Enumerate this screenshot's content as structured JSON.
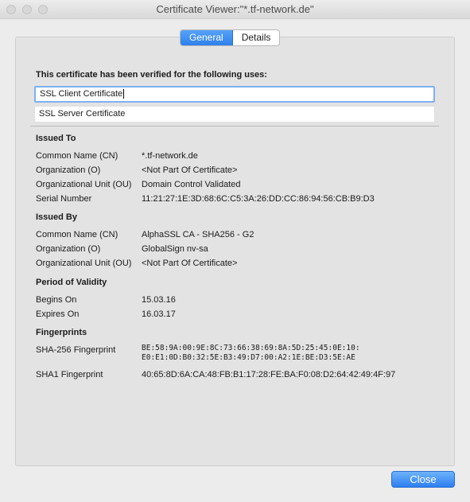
{
  "window": {
    "title": "Certificate Viewer:\"*.tf-network.de\""
  },
  "tabs": [
    {
      "label": "General",
      "active": true
    },
    {
      "label": "Details",
      "active": false
    }
  ],
  "general": {
    "intro": "This certificate has been verified for the following uses:",
    "uses": [
      "SSL Client Certificate",
      "SSL Server Certificate"
    ],
    "issued_to": {
      "heading": "Issued To",
      "cn_label": "Common Name (CN)",
      "cn": "*.tf-network.de",
      "o_label": "Organization (O)",
      "o": "<Not Part Of Certificate>",
      "ou_label": "Organizational Unit (OU)",
      "ou": "Domain Control Validated",
      "serial_label": "Serial Number",
      "serial": "11:21:27:1E:3D:68:6C:C5:3A:26:DD:CC:86:94:56:CB:B9:D3"
    },
    "issued_by": {
      "heading": "Issued By",
      "cn_label": "Common Name (CN)",
      "cn": "AlphaSSL CA - SHA256 - G2",
      "o_label": "Organization (O)",
      "o": "GlobalSign nv-sa",
      "ou_label": "Organizational Unit (OU)",
      "ou": "<Not Part Of Certificate>"
    },
    "validity": {
      "heading": "Period of Validity",
      "begins_label": "Begins On",
      "begins": "15.03.16",
      "expires_label": "Expires On",
      "expires": "16.03.17"
    },
    "fingerprints": {
      "heading": "Fingerprints",
      "sha256_label": "SHA-256 Fingerprint",
      "sha256_line1": "BE:58:9A:00:9E:8C:73:66:38:69:8A:5D:25:45:0E:10:",
      "sha256_line2": "E0:E1:0D:B0:32:5E:B3:49:D7:00:A2:1E:BE:D3:5E:AE",
      "sha1_label": "SHA1 Fingerprint",
      "sha1": "40:65:8D:6A:CA:48:FB:B1:17:28:FE:BA:F0:08:D2:64:42:49:4F:97"
    }
  },
  "footer": {
    "close_label": "Close"
  },
  "colors": {
    "accent": "#2f7fec",
    "selection_border": "#7db1f2",
    "panel": "#e3e3e3"
  }
}
